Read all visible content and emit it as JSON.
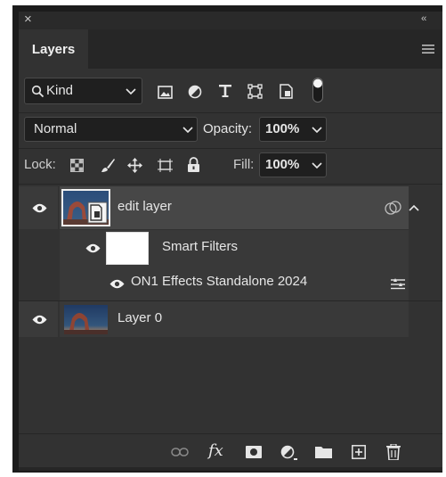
{
  "panel": {
    "title": "Layers",
    "close_glyph": "×",
    "collapse_glyph": "‹‹",
    "menu_icon": "hamburger-menu-icon"
  },
  "filter": {
    "kind_label": "Kind",
    "filter_icons": [
      "image-filter-icon",
      "adjustment-filter-icon",
      "type-filter-icon",
      "shape-filter-icon",
      "smart-object-filter-icon",
      "filter-toggle-icon"
    ]
  },
  "blend": {
    "mode": "Normal",
    "opacity_label": "Opacity:",
    "opacity_value": "100%"
  },
  "lock": {
    "label": "Lock:",
    "fill_label": "Fill:",
    "fill_value": "100%",
    "lock_icons": [
      "lock-transparent-pixels-icon",
      "lock-image-pixels-icon",
      "lock-position-icon",
      "lock-artboard-icon",
      "lock-all-icon"
    ]
  },
  "layers": [
    {
      "name": "edit layer",
      "visible": true,
      "selected": true,
      "type": "smart-object"
    },
    {
      "name": "Smart Filters",
      "visible": true,
      "type": "smart-filters-mask"
    },
    {
      "name": "ON1 Effects Standalone 2024",
      "visible": true,
      "type": "smart-filter"
    },
    {
      "name": "Layer 0",
      "visible": true,
      "type": "pixel"
    }
  ],
  "bottom_toolbar": [
    "link-layers-icon",
    "fx-icon",
    "add-mask-icon",
    "new-adjustment-layer-icon",
    "new-group-icon",
    "new-layer-icon",
    "delete-layer-icon"
  ],
  "bottom_labels": {
    "fx": "fx"
  },
  "colors": {
    "panel_bg": "#323232",
    "selected_row": "#474747",
    "field_bg": "#1f1f1f"
  }
}
